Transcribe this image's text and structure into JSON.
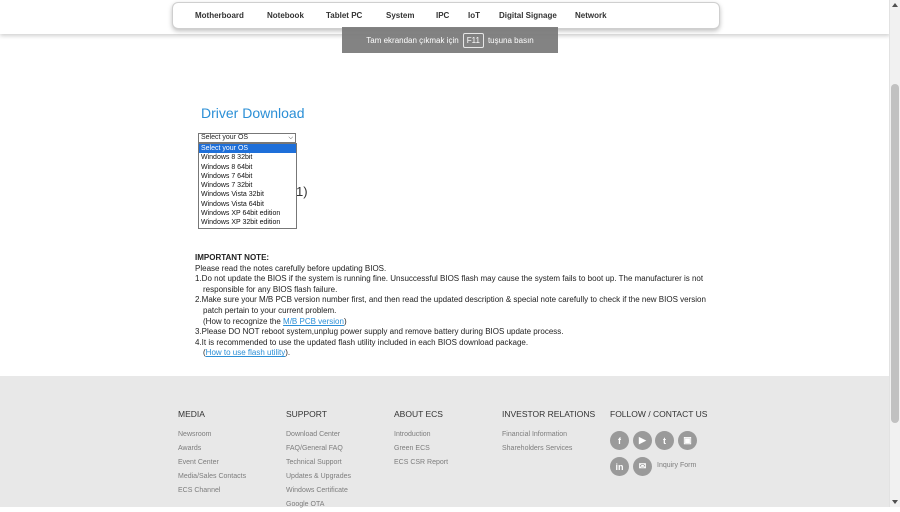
{
  "nav": {
    "items": [
      "Motherboard",
      "Notebook",
      "Tablet PC",
      "System",
      "IPC",
      "IoT",
      "Digital Signage",
      "Network"
    ]
  },
  "toast": {
    "before": "Tam ekrandan çıkmak için",
    "key": "F11",
    "after": "tuşuna basın"
  },
  "main": {
    "title": "Driver Download",
    "select_value": "Select your OS",
    "os_options": [
      "Select your OS",
      "Windows 8 32bit",
      "Windows 8 64bit",
      "Windows 7 64bit",
      "Windows 7 32bit",
      "Windows Vista 32bit",
      "Windows Vista 64bit",
      "Windows XP 64bit edition",
      "Windows XP 32bit edition"
    ],
    "partial_text": "1)"
  },
  "notes": {
    "heading": "IMPORTANT NOTE:",
    "intro": "Please read the notes carefully before updating BIOS.",
    "item1a": "1.Do not update the BIOS if the system is running fine. Unsuccessful BIOS flash may cause the system fails to boot up. The manufacturer is not",
    "item1b": "responsible for any BIOS flash failure.",
    "item2a": "2.Make sure your M/B PCB version number first, and then read the updated description & special note carefully to check if the new BIOS version",
    "item2b": "patch pertain to your current problem.",
    "item2c_pre": "(How to recognize the ",
    "item2c_link": "M/B PCB version",
    "item2c_post": ")",
    "item3": "3.Please DO NOT reboot system,unplug power supply and remove battery during BIOS update process.",
    "item4": "4.It is recommended to use the updated flash utility included in each BIOS download package.",
    "item4b_pre": "(",
    "item4b_link": "How to use flash utility",
    "item4b_post": ")."
  },
  "footer": {
    "media": {
      "heading": "MEDIA",
      "links": [
        "Newsroom",
        "Awards",
        "Event Center",
        "Media/Sales Contacts",
        "ECS Channel"
      ]
    },
    "support": {
      "heading": "SUPPORT",
      "links": [
        "Download Center",
        "FAQ/General FAQ",
        "Technical Support",
        "Updates & Upgrades",
        "Windows Certificate",
        "Google OTA"
      ]
    },
    "about": {
      "heading": "ABOUT ECS",
      "links": [
        "Introduction",
        "Green ECS",
        "ECS CSR Report"
      ]
    },
    "investor": {
      "heading": "INVESTOR RELATIONS",
      "links": [
        "Financial Information",
        "Shareholders Services"
      ]
    },
    "follow": {
      "heading": "FOLLOW / CONTACT US",
      "inquiry": "Inquiry Form"
    },
    "social_icons": [
      "facebook-icon",
      "youtube-icon",
      "twitter-icon",
      "instagram-icon",
      "linkedin-icon",
      "mail-icon"
    ]
  }
}
